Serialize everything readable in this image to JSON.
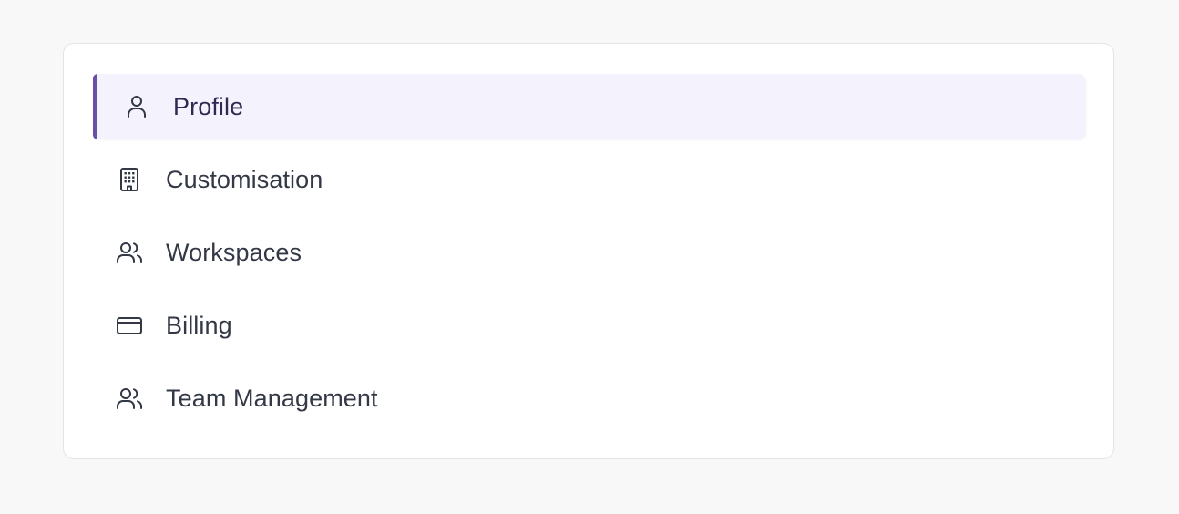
{
  "theme": {
    "accent": "#6b4fa6",
    "active_background": "#f3f2fd",
    "text": "#333846"
  },
  "settings_nav": {
    "items": [
      {
        "label": "Profile",
        "icon": "user-icon",
        "active": true
      },
      {
        "label": "Customisation",
        "icon": "building-icon",
        "active": false
      },
      {
        "label": "Workspaces",
        "icon": "users-icon",
        "active": false
      },
      {
        "label": "Billing",
        "icon": "credit-card-icon",
        "active": false
      },
      {
        "label": "Team Management",
        "icon": "users-icon",
        "active": false
      }
    ]
  }
}
